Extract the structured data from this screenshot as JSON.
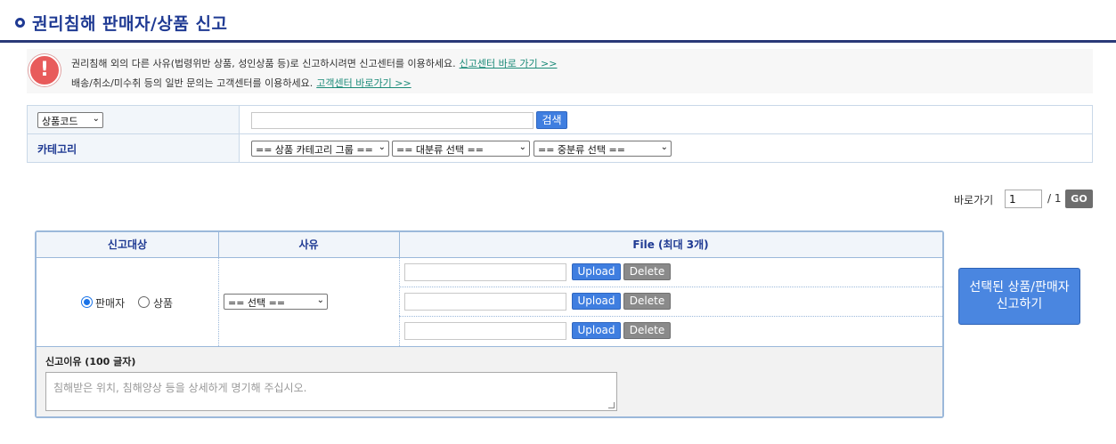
{
  "header": {
    "title": "권리침해 판매자/상품 신고"
  },
  "notice": {
    "line1_text": "권리침해 외의 다른 사유(법령위반 상품, 성인상품 등)로 신고하시려면 신고센터를 이용하세요.",
    "line1_link": "신고센터 바로 가기 >>",
    "line2_text": "배송/취소/미수취 등의 일반 문의는 고객센터를 이용하세요.",
    "line2_link": "고객센터 바로가기 >>",
    "icon": "alert-icon",
    "icon_glyph": "!"
  },
  "search": {
    "code_select": "상품코드",
    "search_button": "검색",
    "category_label": "카테고리",
    "category_group_select": "== 상품 카테고리 그룹 ==",
    "major_select": "== 대분류 선택 ==",
    "middle_select": "== 중분류 선택 =="
  },
  "pagination": {
    "goto_label": "바로가기",
    "page_value": "1",
    "total": "/ 1",
    "go_button": "GO"
  },
  "report": {
    "col_target": "신고대상",
    "col_reason": "사유",
    "col_file": "File (최대 3개)",
    "radio_seller": "판매자",
    "radio_product": "상품",
    "reason_select": "== 선택 ==",
    "upload_label": "Upload",
    "delete_label": "Delete",
    "reason_title": "신고이유 (100 글자)",
    "reason_placeholder": "침해받은 위치, 침해양상 등을 상세하게 명기해 주십시오."
  },
  "submit": {
    "line1": "선택된 상품/판매자",
    "line2": "신고하기"
  },
  "colors": {
    "title": "#1f3a93",
    "link": "#1a8a78",
    "button_blue": "#3f7ee0",
    "button_gray": "#8a8a8a",
    "alert": "#e85b5b"
  }
}
